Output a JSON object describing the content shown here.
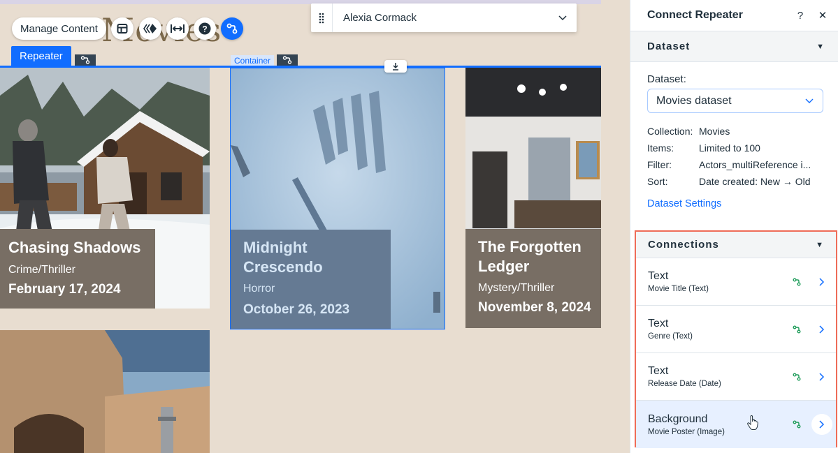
{
  "canvas": {
    "background_title": "Movies",
    "toolbar": {
      "manage_content": "Manage Content"
    },
    "tags": {
      "repeater": "Repeater",
      "container": "Container"
    },
    "user_selector": {
      "name": "Alexia Cormack"
    },
    "cards": [
      {
        "title": "Chasing Shadows",
        "genre": "Crime/Thriller",
        "date": "February 17, 2024"
      },
      {
        "title": "Midnight Crescendo",
        "genre": "Horror",
        "date": "October 26, 2023"
      },
      {
        "title": "The Forgotten Ledger",
        "genre": "Mystery/Thriller",
        "date": "November 8, 2024"
      }
    ],
    "colors": {
      "selection": "#116dff",
      "overlay_brown": "#786e64",
      "overlay_blue": "#657a93"
    }
  },
  "panel": {
    "title": "Connect Repeater",
    "help": "?",
    "close": "✕",
    "dataset_section": {
      "title": "Dataset",
      "label": "Dataset:",
      "selected": "Movies dataset",
      "details": [
        {
          "k": "Collection:",
          "v": "Movies"
        },
        {
          "k": "Items:",
          "v": "Limited to 100"
        },
        {
          "k": "Filter:",
          "v": "Actors_multiReference i..."
        },
        {
          "k": "Sort:",
          "v": "Date created: New → Old"
        }
      ],
      "settings_link": "Dataset Settings"
    },
    "connections_section": {
      "title": "Connections",
      "rows": [
        {
          "main": "Text",
          "sub": "Movie Title (Text)"
        },
        {
          "main": "Text",
          "sub": "Genre (Text)"
        },
        {
          "main": "Text",
          "sub": "Release Date (Date)"
        },
        {
          "main": "Background",
          "sub": "Movie Poster (Image)"
        }
      ]
    },
    "colors": {
      "highlight_border": "#ef6c58",
      "link_icon": "#1f9c5a",
      "accent": "#116dff"
    }
  }
}
